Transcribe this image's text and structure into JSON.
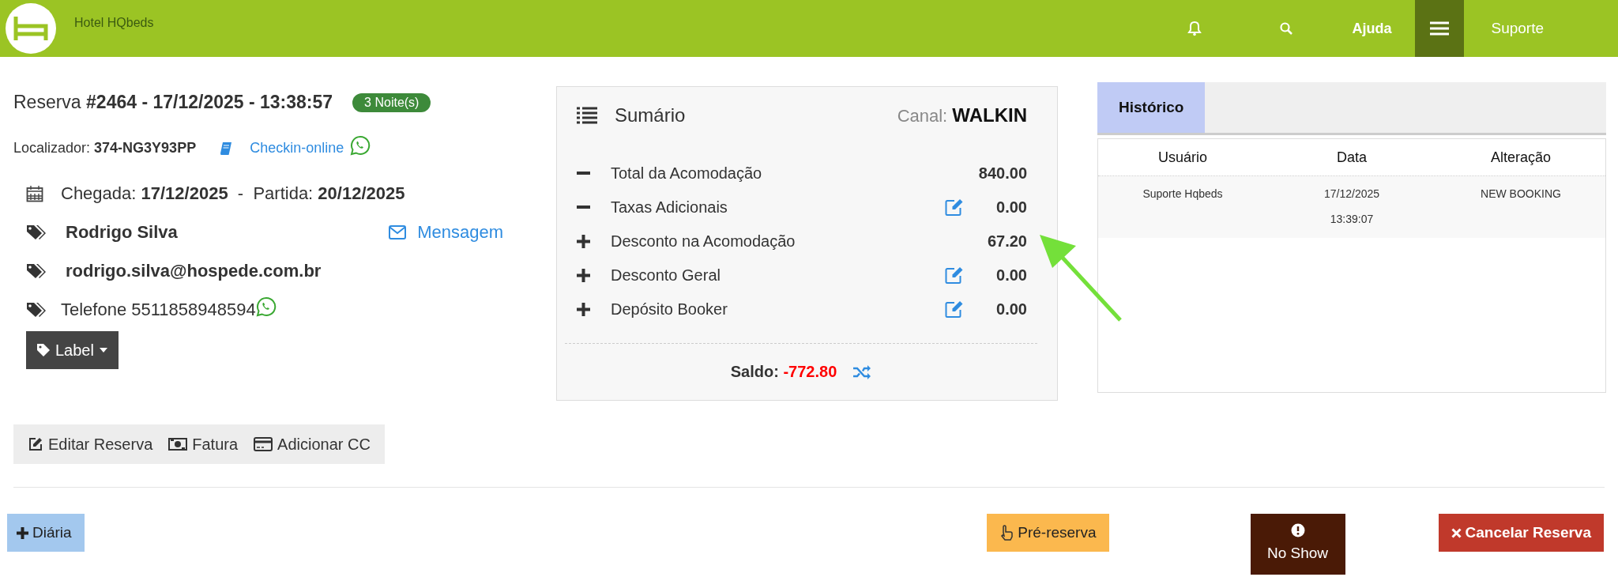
{
  "topbar": {
    "brand": "Hotel HQbeds",
    "help": "Ajuda",
    "user": "Suporte"
  },
  "booking": {
    "title_prefix": "Reserva",
    "title": "#2464 - 17/12/2025 - 13:38:57",
    "nights": "3 Noite(s)",
    "locator_label": "Localizador:",
    "locator": "374-NG3Y93PP",
    "checkin_link": "Checkin-online",
    "arrival_label": "Chegada:",
    "arrival": "17/12/2025",
    "date_separator": "-",
    "departure_label": "Partida:",
    "departure": "20/12/2025",
    "guest_name": "Rodrigo Silva",
    "message_link": "Mensagem",
    "email": "rodrigo.silva@hospede.com.br",
    "phone": "Telefone 5511858948594",
    "label_button": "Label"
  },
  "actions": [
    {
      "kind": "edit",
      "label": "Editar Reserva"
    },
    {
      "kind": "invoice",
      "label": "Fatura"
    },
    {
      "kind": "card",
      "label": "Adicionar CC"
    }
  ],
  "summary": {
    "title": "Sumário",
    "channel_label": "Canal:",
    "channel": "WALKIN",
    "rows": [
      {
        "kind": "minus",
        "label": "Total da Acomodação",
        "editable": false,
        "value": "840.00"
      },
      {
        "kind": "minus",
        "label": "Taxas Adicionais",
        "editable": true,
        "value": "0.00"
      },
      {
        "kind": "plus",
        "label": "Desconto na Acomodação",
        "editable": false,
        "value": "67.20"
      },
      {
        "kind": "plus",
        "label": "Desconto Geral",
        "editable": true,
        "value": "0.00"
      },
      {
        "kind": "plus",
        "label": "Depósito Booker",
        "editable": true,
        "value": "0.00"
      }
    ],
    "balance_label": "Saldo:",
    "balance": "-772.80"
  },
  "history": {
    "tabs": [
      {
        "label": "Histórico",
        "selected": true
      }
    ],
    "columns": [
      "Usuário",
      "Data",
      "Alteração"
    ],
    "rows": [
      {
        "user": "Suporte Hqbeds",
        "date": "17/12/2025",
        "time": "13:39:07",
        "change": "NEW BOOKING"
      }
    ]
  },
  "footer_buttons": [
    {
      "kind": "add",
      "label": "Diária"
    },
    {
      "kind": "pre",
      "label": "Pré-reserva"
    },
    {
      "kind": "noshow",
      "label": "No Show"
    },
    {
      "kind": "cancel",
      "label": "Cancelar Reserva"
    }
  ]
}
